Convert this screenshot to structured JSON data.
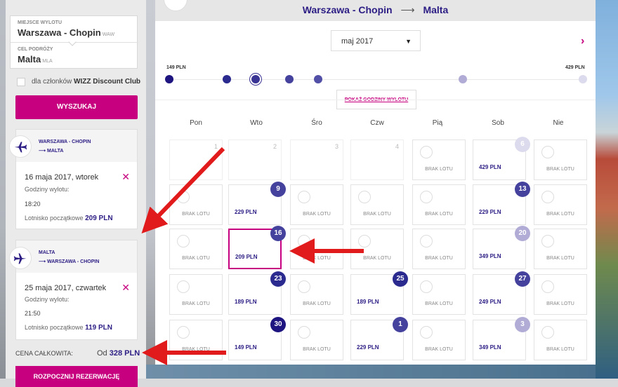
{
  "search": {
    "origin_label": "MIEJSCE WYLOTU",
    "origin_value": "Warszawa - Chopin",
    "origin_code": "WAW",
    "dest_label": "CEL PODRÓŻY",
    "dest_value": "Malta",
    "dest_code": "MLA",
    "club_checkbox_prefix": "dla członków",
    "club_checkbox_bold": "WIZZ Discount Club",
    "search_button": "WYSZUKAJ"
  },
  "flights": [
    {
      "from": "WARSZAWA - CHOPIN",
      "to": "MALTA",
      "date": "16 maja 2017, wtorek",
      "hours_label": "Godziny wylotu:",
      "time": "18:20",
      "price_label": "Lotnisko początkowe",
      "price": "209 PLN"
    },
    {
      "from": "MALTA",
      "to": "WARSZAWA - CHOPIN",
      "date": "25 maja 2017, czwartek",
      "hours_label": "Godziny wylotu:",
      "time": "21:50",
      "price_label": "Lotnisko początkowe",
      "price": "119 PLN"
    }
  ],
  "total": {
    "label": "CENA CAŁKOWITA:",
    "prefix": "Od",
    "value": "328 PLN",
    "book_button": "ROZPOCZNIJ REZERWACJĘ"
  },
  "calendar": {
    "route_from": "Warszawa - Chopin",
    "route_arrow": "⟶",
    "route_to": "Malta",
    "month": "maj 2017",
    "price_min": "149 PLN",
    "price_max": "429 PLN",
    "show_hours_button": "POKAŻ GODZINY WYLOTU",
    "day_names": [
      "Pon",
      "Wto",
      "Śro",
      "Czw",
      "Pią",
      "Sob",
      "Nie"
    ],
    "no_flight": "BRAK LOTU",
    "weeks": [
      [
        {
          "day": "1",
          "state": "empty"
        },
        {
          "day": "2",
          "state": "empty"
        },
        {
          "day": "3",
          "state": "empty"
        },
        {
          "day": "4",
          "state": "empty"
        },
        {
          "day": "",
          "state": "noflight"
        },
        {
          "day": "6",
          "state": "price",
          "price": "429 PLN",
          "badge": "light"
        },
        {
          "day": "",
          "state": "noflight"
        }
      ],
      [
        {
          "day": "",
          "state": "noflight"
        },
        {
          "day": "9",
          "state": "price",
          "price": "229 PLN",
          "badge": "mid"
        },
        {
          "day": "",
          "state": "noflight"
        },
        {
          "day": "",
          "state": "noflight"
        },
        {
          "day": "",
          "state": "noflight"
        },
        {
          "day": "13",
          "state": "price",
          "price": "229 PLN",
          "badge": "mid"
        },
        {
          "day": "",
          "state": "noflight"
        }
      ],
      [
        {
          "day": "",
          "state": "noflight"
        },
        {
          "day": "16",
          "state": "price",
          "price": "209 PLN",
          "badge": "mid",
          "selected": true
        },
        {
          "day": "",
          "state": "noflight"
        },
        {
          "day": "",
          "state": "noflight"
        },
        {
          "day": "",
          "state": "noflight"
        },
        {
          "day": "20",
          "state": "price",
          "price": "349 PLN",
          "badge": "pale"
        },
        {
          "day": "",
          "state": "noflight"
        }
      ],
      [
        {
          "day": "",
          "state": "noflight"
        },
        {
          "day": "23",
          "state": "price",
          "price": "189 PLN",
          "badge": "dark"
        },
        {
          "day": "",
          "state": "noflight"
        },
        {
          "day": "25",
          "state": "price",
          "price": "189 PLN",
          "badge": "dark"
        },
        {
          "day": "",
          "state": "noflight"
        },
        {
          "day": "27",
          "state": "price",
          "price": "249 PLN",
          "badge": "mid"
        },
        {
          "day": "",
          "state": "noflight"
        }
      ],
      [
        {
          "day": "",
          "state": "noflight"
        },
        {
          "day": "30",
          "state": "price",
          "price": "149 PLN",
          "badge": "darkest"
        },
        {
          "day": "",
          "state": "noflight"
        },
        {
          "day": "1",
          "state": "price",
          "price": "229 PLN",
          "badge": "mid"
        },
        {
          "day": "",
          "state": "noflight"
        },
        {
          "day": "3",
          "state": "price",
          "price": "349 PLN",
          "badge": "pale"
        },
        {
          "day": "",
          "state": "noflight"
        }
      ]
    ]
  },
  "colors": {
    "brand": "#c6007e",
    "navy": "#2b1d84",
    "badge_darkest": "#1e1580",
    "badge_dark": "#2a2a8f",
    "badge_mid": "#45429e",
    "badge_pale": "#b0acd6",
    "badge_light": "#dcdbed",
    "annotation": "#e11b1b"
  },
  "icons": {
    "plane": "airplane-icon",
    "close": "close-icon",
    "next": "chevron-right-icon",
    "caret": "caret-down-icon"
  }
}
